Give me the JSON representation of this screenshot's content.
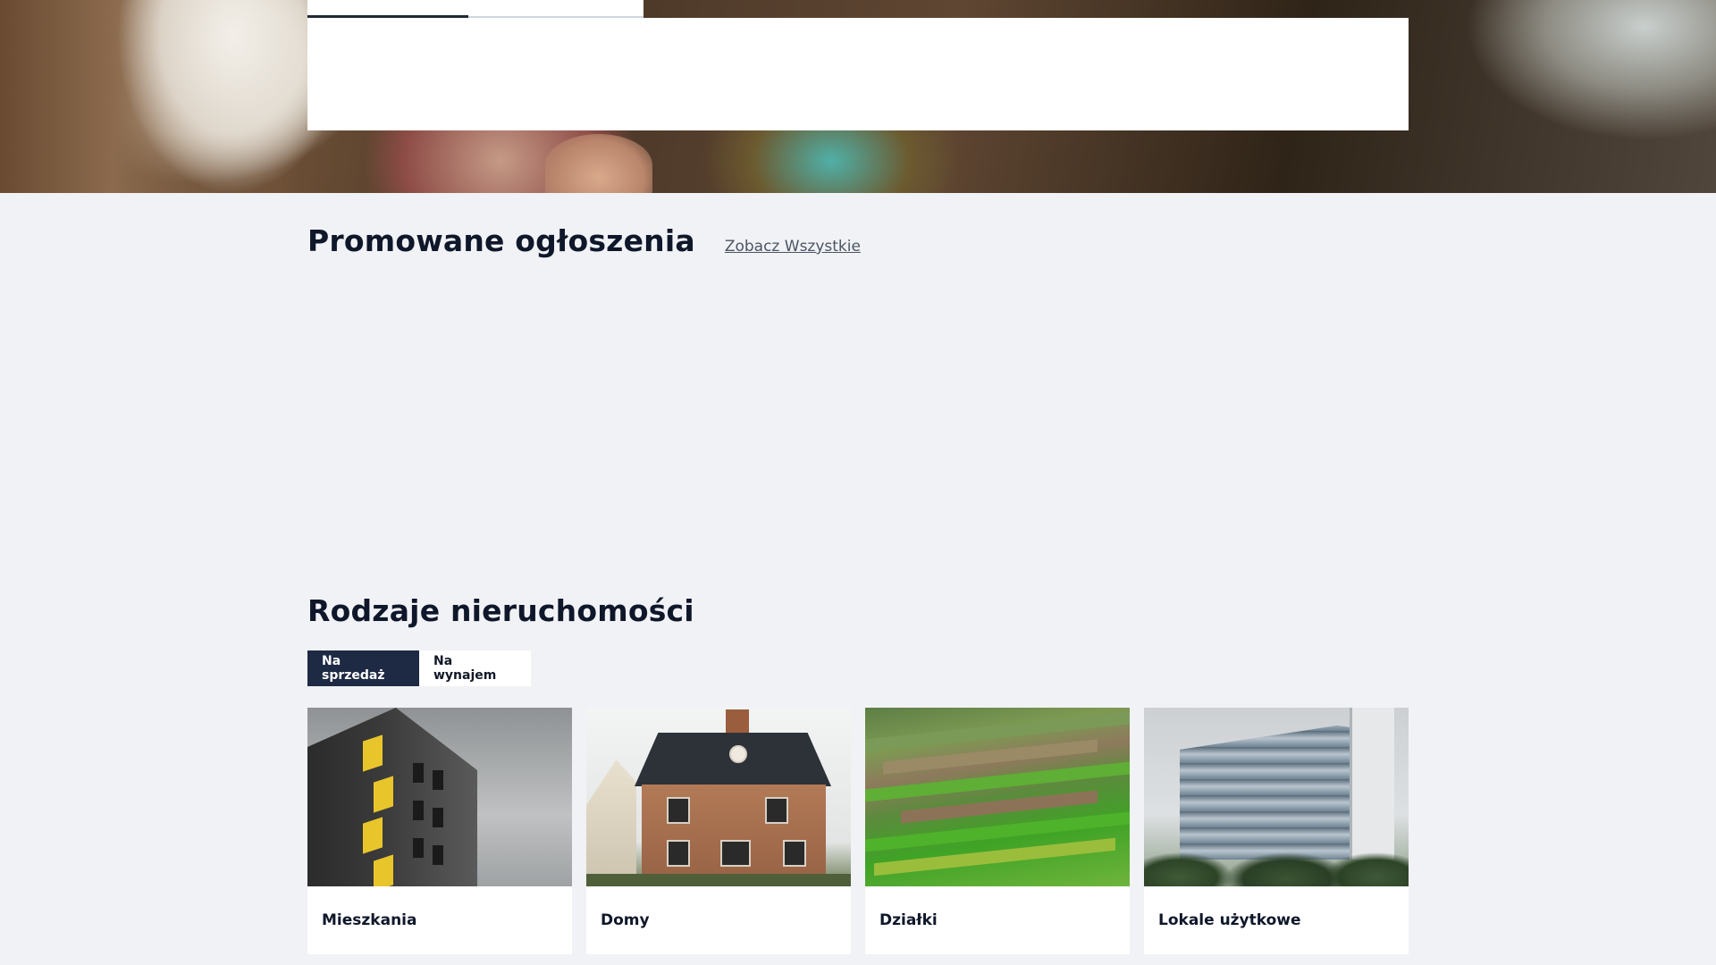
{
  "search": {
    "tabs": [
      {
        "label": "",
        "active": true
      },
      {
        "label": "",
        "active": false
      }
    ]
  },
  "promoted": {
    "title": "Promowane ogłoszenia",
    "see_all_label": "Zobacz Wszystkie"
  },
  "property_types": {
    "title": "Rodzaje nieruchomości",
    "tabs": [
      {
        "label": "Na sprzedaż",
        "active": true
      },
      {
        "label": "Na wynajem",
        "active": false
      }
    ],
    "cards": [
      {
        "label": "Mieszkania",
        "image": "apartment-building-photo"
      },
      {
        "label": "Domy",
        "image": "brick-house-photo"
      },
      {
        "label": "Działki",
        "image": "farm-fields-photo"
      },
      {
        "label": "Lokale użytkowe",
        "image": "office-building-photo"
      }
    ]
  },
  "colors": {
    "page_background": "#f1f2f5",
    "accent_dark": "#1e2a44",
    "card_background": "#ffffff"
  }
}
